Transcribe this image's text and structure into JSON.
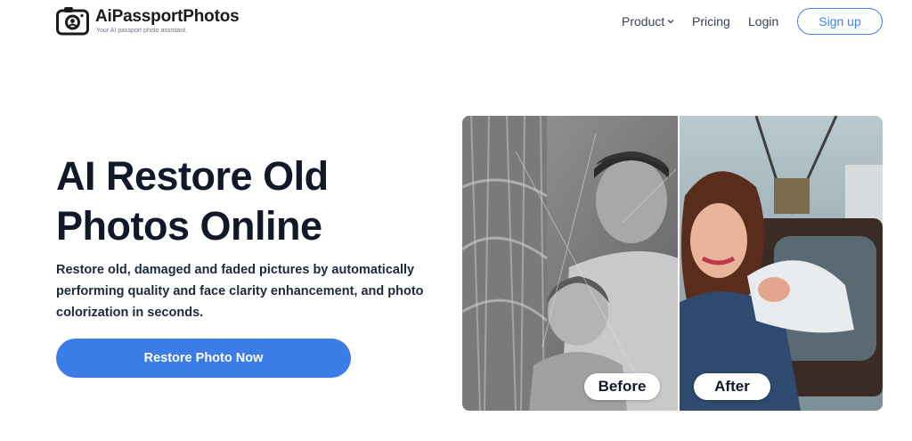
{
  "brand": {
    "name": "AiPassportPhotos",
    "tagline": "Your AI passport photo assistant."
  },
  "nav": {
    "product": "Product",
    "pricing": "Pricing",
    "login": "Login",
    "signup": "Sign up"
  },
  "hero": {
    "title_line1": "AI Restore Old",
    "title_line2": "Photos Online",
    "description": "Restore old, damaged and faded pictures by automatically performing quality and face clarity enhancement, and photo colorization in seconds.",
    "cta": "Restore Photo Now"
  },
  "compare": {
    "before_label": "Before",
    "after_label": "After"
  },
  "colors": {
    "accent": "#3b7ce6",
    "outline": "#3b82f6",
    "text": "#111827"
  }
}
